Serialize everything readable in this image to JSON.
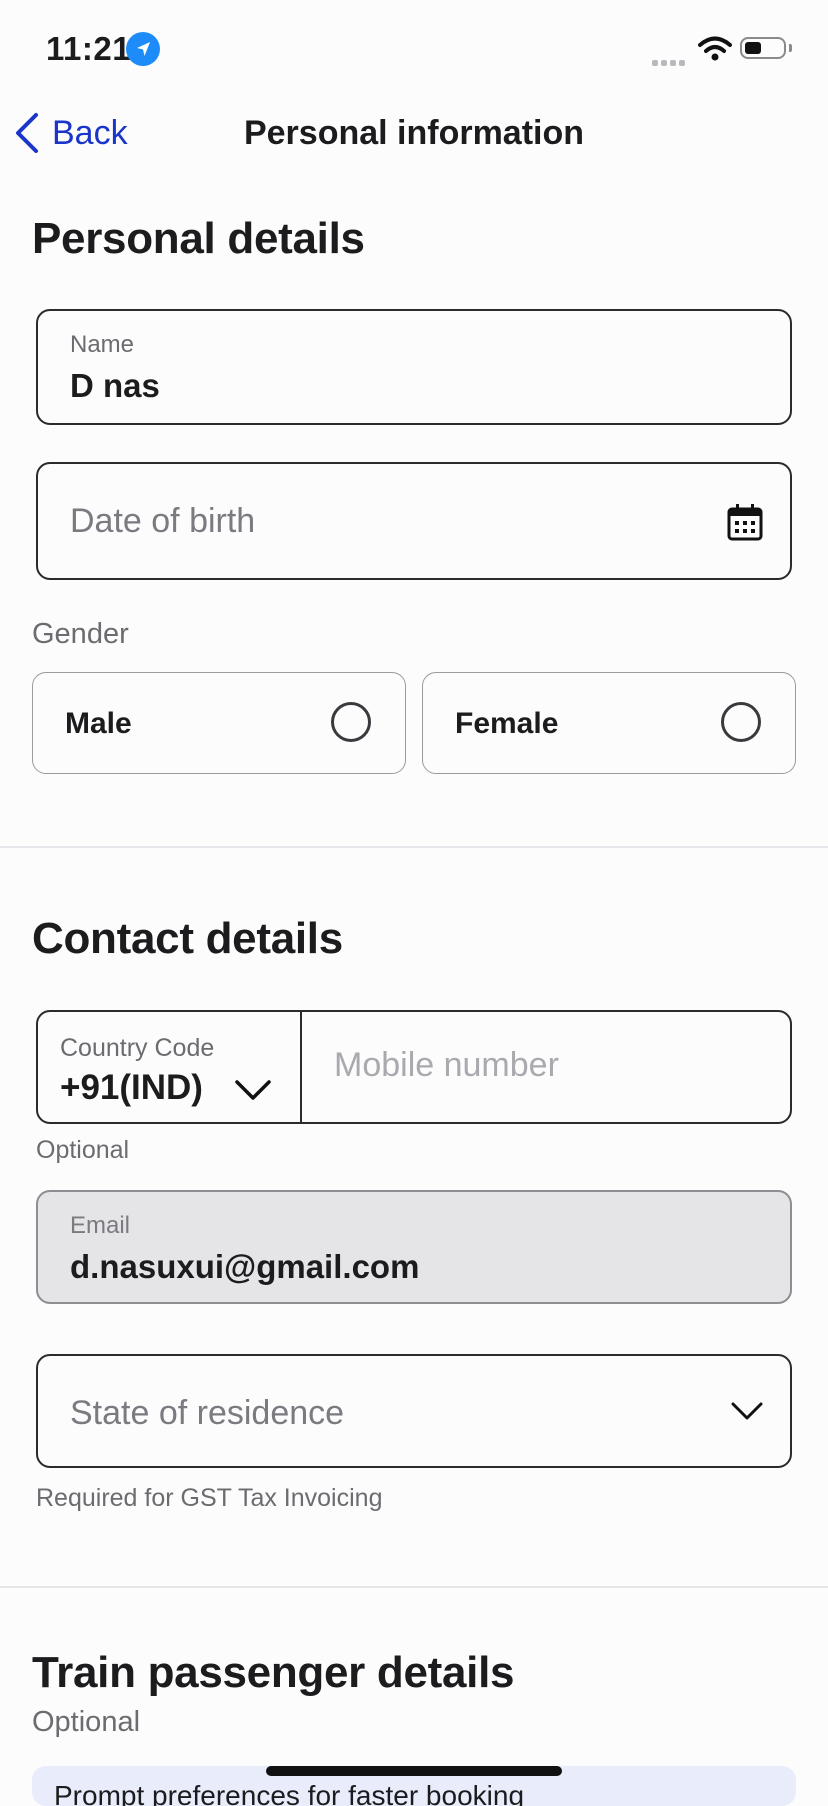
{
  "status_bar": {
    "time": "11:21"
  },
  "nav": {
    "back_label": "Back",
    "title": "Personal information"
  },
  "personal": {
    "title": "Personal details",
    "name_label": "Name",
    "name_value": "D nas",
    "dob_placeholder": "Date of birth",
    "gender_label": "Gender",
    "gender_options": [
      "Male",
      "Female"
    ]
  },
  "contact": {
    "title": "Contact details",
    "country_code_label": "Country Code",
    "country_code_value": "+91(IND)",
    "mobile_placeholder": "Mobile number",
    "mobile_helper": "Optional",
    "email_label": "Email",
    "email_value": "d.nasuxui@gmail.com",
    "state_placeholder": "State of residence",
    "state_helper": "Required for GST Tax Invoicing"
  },
  "train": {
    "title": "Train passenger details",
    "subtitle": "Optional",
    "banner_text": "Prompt preferences for faster booking"
  },
  "colors": {
    "accent": "#1a35c9",
    "location_icon": "#1d8cf8"
  },
  "icons": [
    "location-arrow-icon",
    "wifi-icon",
    "battery-icon",
    "chevron-left-icon",
    "calendar-icon",
    "chevron-down-icon"
  ]
}
